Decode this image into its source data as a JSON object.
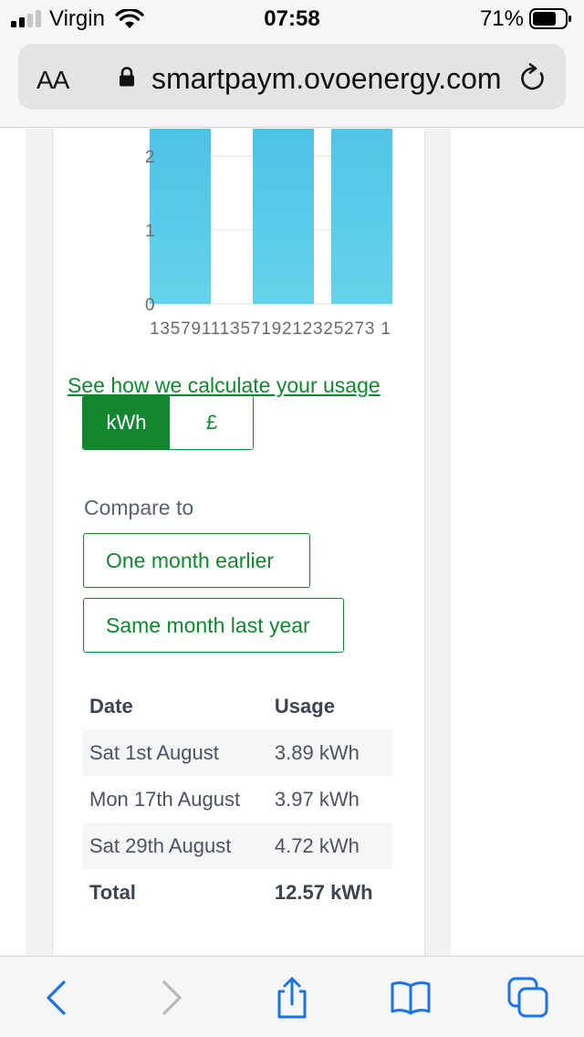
{
  "status": {
    "carrier": "Virgin",
    "time": "07:58",
    "battery": "71%"
  },
  "browser": {
    "text_size_label": "AA",
    "url": "smartpaym.ovoenergy.com"
  },
  "chart_data": {
    "type": "bar",
    "y_ticks": [
      "0",
      "1",
      "2"
    ],
    "x_tick_text": "1357911135719212325273 1",
    "bars": [
      {
        "label": "Sat 1st August",
        "value": 3.89
      },
      {
        "label": "Mon 17th August",
        "value": 3.97
      },
      {
        "label": "Sat 29th August",
        "value": 4.72
      }
    ],
    "bar_color_top": "#3fb8e6",
    "bar_color_bottom": "#64d3ea"
  },
  "links": {
    "calculate": "See how we calculate your usage"
  },
  "units": {
    "kwh": "kWh",
    "pound": "£",
    "selected": "kwh"
  },
  "compare": {
    "label": "Compare to",
    "month_earlier": "One month earlier",
    "last_year": "Same month last year"
  },
  "table": {
    "headers": [
      "Date",
      "Usage"
    ],
    "rows": [
      [
        "Sat 1st August",
        "3.89 kWh"
      ],
      [
        "Mon 17th August",
        "3.97 kWh"
      ],
      [
        "Sat 29th August",
        "4.72 kWh"
      ]
    ],
    "total": [
      "Total",
      "12.57 kWh"
    ]
  },
  "colors": {
    "accent_green": "#13872f"
  }
}
